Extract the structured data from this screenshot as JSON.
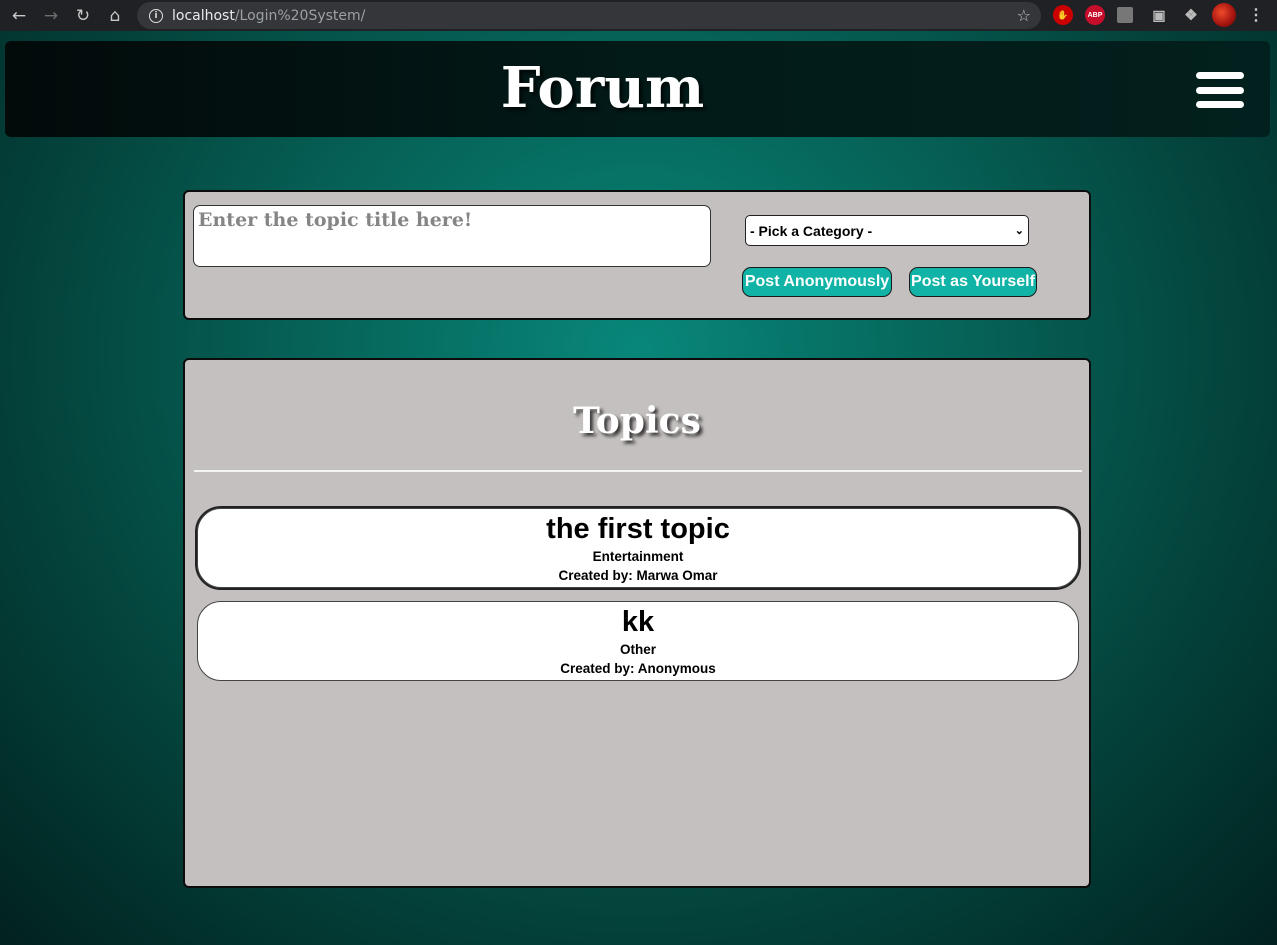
{
  "browser": {
    "url_host": "localhost",
    "url_path": "/Login%20System/",
    "extensions": [
      "hand-stop-icon",
      "adblock-plus-icon",
      "extension-icon",
      "camera-icon",
      "puzzle-icon",
      "profile-avatar"
    ]
  },
  "header": {
    "logo": "Forum"
  },
  "new_topic": {
    "title_placeholder": "Enter the topic title here!",
    "category_selected": "- Pick a Category -",
    "post_anonymously_label": "Post Anonymously",
    "post_as_yourself_label": "Post as Yourself"
  },
  "topics": {
    "heading": "Topics",
    "items": [
      {
        "title": "the first topic",
        "category": "Entertainment",
        "author": "Created by: Marwa Omar"
      },
      {
        "title": "kk",
        "category": "Other",
        "author": "Created by: Anonymous"
      }
    ]
  },
  "colors": {
    "accent": "#10b3a5",
    "panel": "#c4c0bf",
    "background": "#066459"
  }
}
